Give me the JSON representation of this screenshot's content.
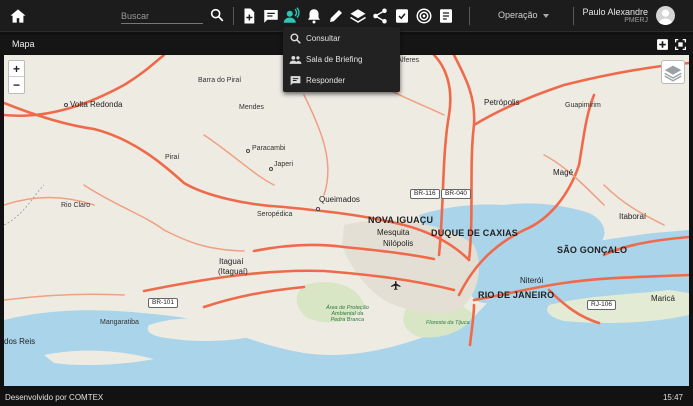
{
  "header": {
    "search_placeholder": "Buscar",
    "operation_label": "Operação",
    "user_name": "Paulo Alexandre",
    "user_org": "PMERJ",
    "active_color": "#2ec4b6",
    "toolbar_icons": [
      "add-document-icon",
      "message-icon",
      "user-signal-icon",
      "bell-icon",
      "pencil-icon",
      "layers-icon",
      "share-icon",
      "checklist-icon",
      "radar-icon",
      "notes-icon"
    ]
  },
  "panel": {
    "title": "Mapa"
  },
  "dropdown": {
    "items": [
      {
        "label": "Consultar",
        "icon": "search-icon"
      },
      {
        "label": "Sala de Briefing",
        "icon": "group-icon"
      },
      {
        "label": "Responder",
        "icon": "reply-icon"
      }
    ]
  },
  "map": {
    "zoom_in": "+",
    "zoom_out": "−",
    "places": {
      "volta_redonda": "Volta Redonda",
      "barra_do_pirai": "Barra do Piraí",
      "mendes": "Mendes",
      "paracambi": "Paracambi",
      "japeri": "Japeri",
      "pirai": "Piraí",
      "rio_claro": "Rio Claro",
      "queimados": "Queimados",
      "seropedica": "Seropédica",
      "nova_iguacu": "NOVA IGUAÇU",
      "mesquita": "Mesquita",
      "nilopolis": "Nilópolis",
      "duque_de_caxias": "DUQUE DE CAXIAS",
      "itaguai": "Itaguaí",
      "itaguai2": "(Itaguaí)",
      "mangaratiba": "Mangaratiba",
      "dos_reis": "dos Reis",
      "petropolis": "Petrópolis",
      "guapimirim": "Guapimirim",
      "mage": "Magé",
      "itaborai": "Itaboraí",
      "sao_goncalo": "SÃO GONÇALO",
      "niteroi": "Niterói",
      "rio_de_janeiro": "RIO DE JANEIRO",
      "marica": "Maricá",
      "alferes": "Paty do Alferes",
      "area_protecao_1": "Área de Proteção",
      "area_protecao_2": "Ambiental da",
      "area_protecao_3": "Pedra Branca",
      "floresta_tijuca": "Floresta da Tijuca"
    },
    "shields": {
      "br116": "BR-116",
      "br040": "BR-040",
      "br101": "BR-101",
      "rj106": "RJ-106"
    }
  },
  "footer": {
    "credit": "Desenvolvido por COMTEX",
    "time": "15:47"
  }
}
